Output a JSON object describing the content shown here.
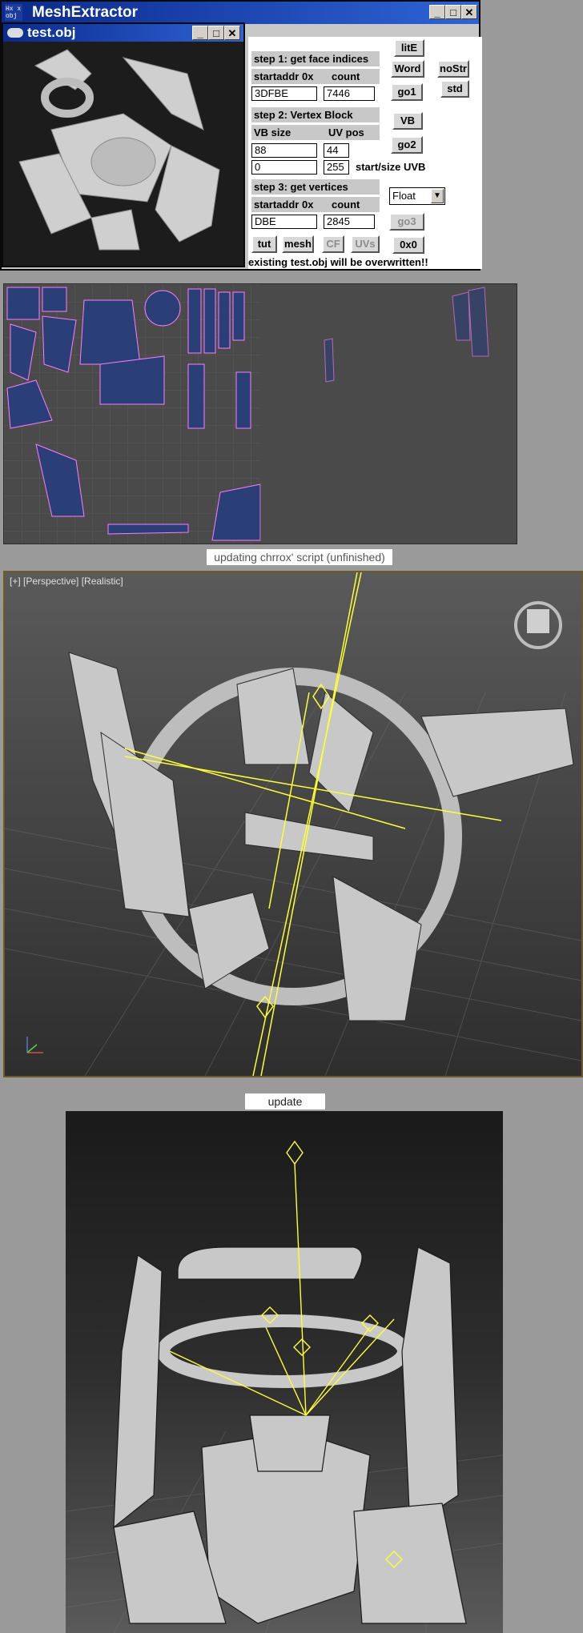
{
  "app": {
    "title": "MeshExtractor",
    "icon_text": "Hx x\nobj",
    "controls": [
      "_",
      "□",
      "✕"
    ]
  },
  "child_window": {
    "title": "test.obj",
    "controls": [
      "_",
      "□",
      "✕"
    ]
  },
  "step1": {
    "heading": "step 1: get face indices",
    "startaddr_label": "startaddr 0x",
    "count_label": "count",
    "startaddr": "3DFBE",
    "count": "7446"
  },
  "step2": {
    "heading": "step 2: Vertex Block",
    "vb_size_label": "VB size",
    "uv_pos_label": "UV pos",
    "vb_size": "88",
    "uv_pos": "44",
    "uvb_start": "0",
    "uvb_size": "255",
    "uvb_label": "start/size UVB"
  },
  "step3": {
    "heading": "step 3: get vertices",
    "startaddr_label": "startaddr 0x",
    "count_label": "count",
    "startaddr": "DBE",
    "count": "2845",
    "format": "Float"
  },
  "buttons": {
    "lite": "litE",
    "word": "Word",
    "nostr": "noStr",
    "std": "std",
    "go1": "go1",
    "vb": "VB",
    "go2": "go2",
    "go3": "go3",
    "tut": "tut",
    "mesh": "mesh",
    "cf": "CF",
    "uvs": "UVs",
    "hex": "0x0"
  },
  "status": "existing test.obj will be overwritten!!",
  "captions": {
    "viewport_caption": "updating chrrox' script (unfinished)",
    "update_caption": "update"
  },
  "viewport": {
    "label": "[+] [Perspective] [Realistic]"
  },
  "colors": {
    "titlebar": "#0a2a8c",
    "bone_lines": "#ffff33",
    "uv_edges": "#ff7cff",
    "uv_fill": "#2a3f78"
  }
}
